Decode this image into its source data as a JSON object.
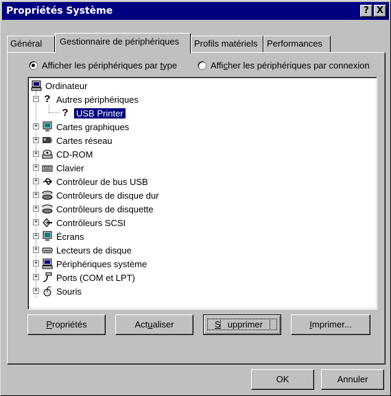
{
  "window": {
    "title": "Propriétés Système",
    "help_label": "?",
    "close_label": "X"
  },
  "tabs": [
    {
      "label": "Général",
      "active": false
    },
    {
      "label": "Gestionnaire de périphériques",
      "active": true
    },
    {
      "label": "Profils matériels",
      "active": false
    },
    {
      "label": "Performances",
      "active": false
    }
  ],
  "view_options": {
    "by_type": {
      "before": "Afficher les périphériques par ",
      "accel": "t",
      "after": "ype",
      "checked": true
    },
    "by_connection": {
      "before": "Affi",
      "accel": "c",
      "after": "her les périphériques par connexion",
      "checked": false
    }
  },
  "tree": {
    "root": "Ordinateur",
    "other_devices": "Autres périphériques",
    "usb_printer": "USB Printer",
    "items": [
      {
        "label": "Cartes graphiques",
        "icon": "monitor-icon"
      },
      {
        "label": "Cartes réseau",
        "icon": "network-card-icon"
      },
      {
        "label": "CD-ROM",
        "icon": "cdrom-icon"
      },
      {
        "label": "Clavier",
        "icon": "keyboard-icon"
      },
      {
        "label": "Contrôleur de bus USB",
        "icon": "usb-icon"
      },
      {
        "label": "Contrôleurs de disque dur",
        "icon": "disk-controller-icon"
      },
      {
        "label": "Contrôleurs de disquette",
        "icon": "floppy-controller-icon"
      },
      {
        "label": "Contrôleurs SCSI",
        "icon": "scsi-icon"
      },
      {
        "label": "Écrans",
        "icon": "monitor-icon"
      },
      {
        "label": "Lecteurs de disque",
        "icon": "disk-drive-icon"
      },
      {
        "label": "Périphériques système",
        "icon": "computer-icon"
      },
      {
        "label": "Ports (COM et LPT)",
        "icon": "port-icon"
      },
      {
        "label": "Souris",
        "icon": "mouse-icon"
      }
    ]
  },
  "buttons": {
    "properties": {
      "accel": "P",
      "rest": "ropriétés"
    },
    "refresh": {
      "before": "Act",
      "accel": "u",
      "after": "aliser"
    },
    "remove": {
      "accel": "S",
      "rest": "upprimer"
    },
    "print": {
      "accel": "I",
      "rest": "mprimer..."
    },
    "ok": "OK",
    "cancel": "Annuler"
  }
}
